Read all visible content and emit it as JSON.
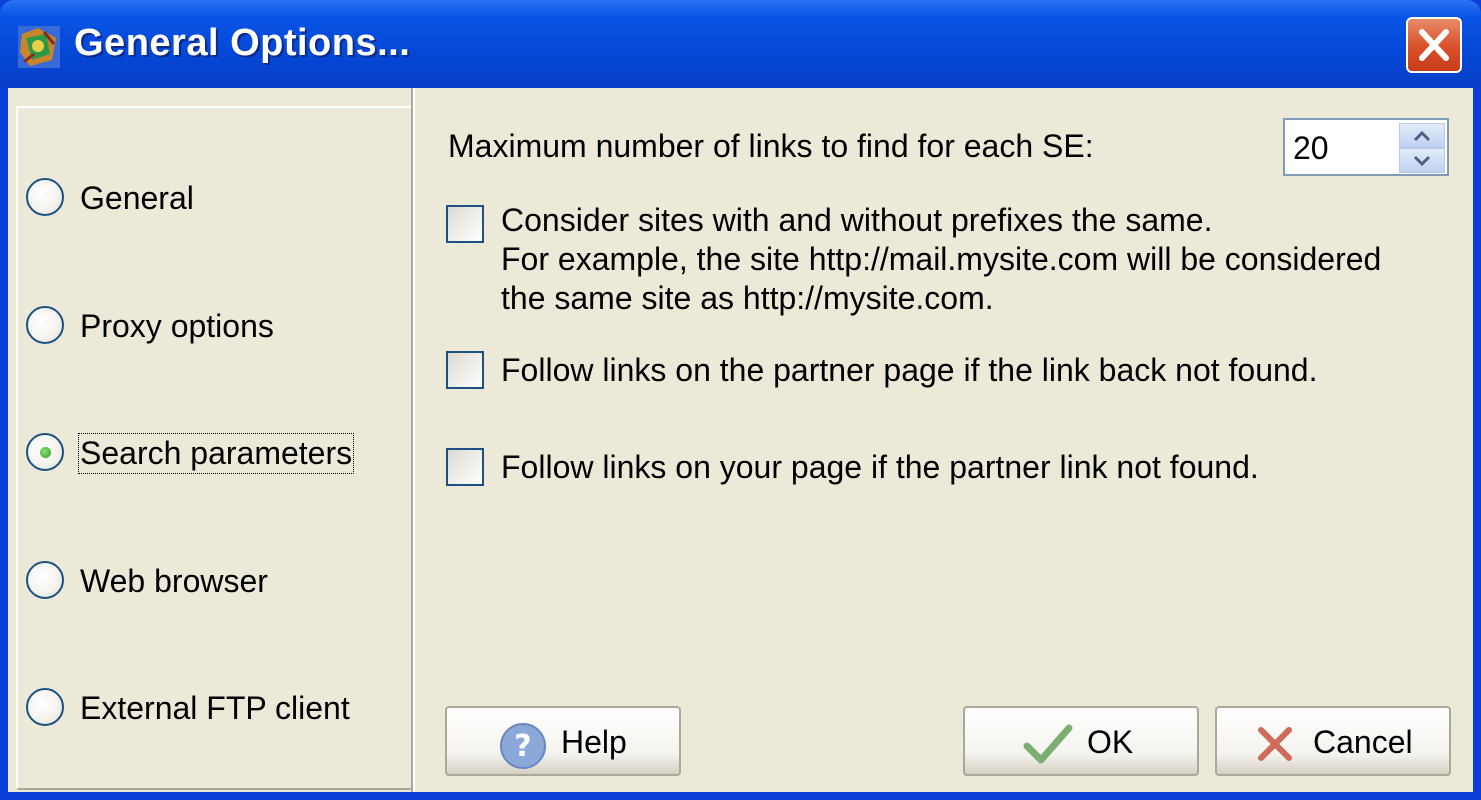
{
  "window": {
    "title": "General Options..."
  },
  "sidebar": {
    "items": [
      {
        "label": "General",
        "selected": false
      },
      {
        "label": "Proxy options",
        "selected": false
      },
      {
        "label": "Search parameters",
        "selected": true
      },
      {
        "label": "Web browser",
        "selected": false
      },
      {
        "label": "External FTP client",
        "selected": false
      }
    ]
  },
  "search": {
    "max_links_label": "Maximum number of links to find for each SE:",
    "max_links_value": "20",
    "checkboxes": [
      {
        "lines": [
          "Consider sites with and without prefixes the same.",
          "For example, the site  http://mail.mysite.com will be considered",
          "the same site as http://mysite.com."
        ],
        "checked": false
      },
      {
        "lines": [
          "Follow links on the partner page if the link back not found."
        ],
        "checked": false
      },
      {
        "lines": [
          "Follow links on your page if the  partner link not found."
        ],
        "checked": false
      }
    ]
  },
  "buttons": {
    "help": "Help",
    "ok": "OK",
    "cancel": "Cancel"
  },
  "colors": {
    "titlebar": "#0447d6",
    "dialog_bg": "#ece9d8",
    "close": "#d8502a",
    "radio_dot": "#2a9a18"
  },
  "icons": {
    "app": "app-icon",
    "close": "close-icon",
    "help": "help-icon",
    "ok": "checkmark-icon",
    "cancel": "x-icon"
  }
}
